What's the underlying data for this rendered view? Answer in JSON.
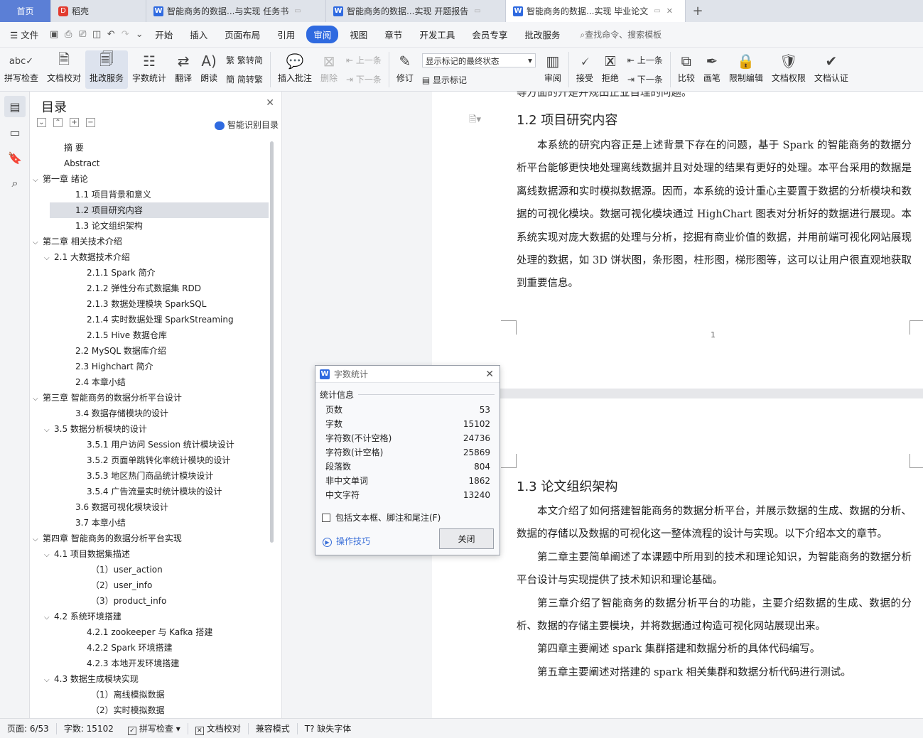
{
  "tabs": [
    {
      "label": "首页",
      "type": "home"
    },
    {
      "label": "稻壳",
      "type": "docer"
    },
    {
      "label": "智能商务的数据...与实现 任务书",
      "type": "doc"
    },
    {
      "label": "智能商务的数据...实现 开题报告",
      "type": "doc"
    },
    {
      "label": "智能商务的数据...实现 毕业论文",
      "type": "doc",
      "active": true
    }
  ],
  "menubar": {
    "file": "文件",
    "items": [
      "开始",
      "插入",
      "页面布局",
      "引用",
      "审阅",
      "视图",
      "章节",
      "开发工具",
      "会员专享",
      "批改服务"
    ],
    "active": "审阅",
    "search": "查找命令、搜索模板"
  },
  "ribbon": {
    "spellcheck": "拼写检查",
    "proofread": "文档校对",
    "correction": "批改服务",
    "wordcount": "字数统计",
    "translate": "翻译",
    "readaloud": "朗读",
    "trad": "繁转简",
    "simp": "简转繁",
    "insert_comment": "插入批注",
    "delete": "删除",
    "prev": "上一条",
    "next": "下一条",
    "revise": "修订",
    "markup_select": "显示标记的最终状态",
    "show_markup": "显示标记",
    "review": "审阅",
    "accept": "接受",
    "reject": "拒绝",
    "prev2": "上一条",
    "next2": "下一条",
    "compare": "比较",
    "pen": "画笔",
    "restrict": "限制编辑",
    "doc_perm": "文档权限",
    "doc_cert": "文档认证"
  },
  "toc": {
    "title": "目录",
    "smart": "智能识别目录",
    "items": [
      {
        "label": "摘  要",
        "level": 1,
        "arrow": ""
      },
      {
        "label": "Abstract",
        "level": 1,
        "arrow": ""
      },
      {
        "label": "第一章  绪论",
        "level": 0,
        "arrow": "v"
      },
      {
        "label": "1.1 项目背景和意义",
        "level": 2,
        "arrow": ""
      },
      {
        "label": "1.2 项目研究内容",
        "level": 2,
        "arrow": "",
        "selected": true
      },
      {
        "label": "1.3 论文组织架构",
        "level": 2,
        "arrow": ""
      },
      {
        "label": "第二章  相关技术介绍",
        "level": 0,
        "arrow": "v"
      },
      {
        "label": "2.1 大数据技术介绍",
        "level": 1.5,
        "arrow": "v"
      },
      {
        "label": "2.1.1  Spark 简介",
        "level": 3,
        "arrow": ""
      },
      {
        "label": "2.1.2  弹性分布式数据集 RDD",
        "level": 3,
        "arrow": ""
      },
      {
        "label": "2.1.3 数据处理模块 SparkSQL",
        "level": 3,
        "arrow": ""
      },
      {
        "label": "2.1.4 实时数据处理 SparkStreaming",
        "level": 3,
        "arrow": ""
      },
      {
        "label": "2.1.5 Hive 数据仓库",
        "level": 3,
        "arrow": ""
      },
      {
        "label": "2.2 MySQL 数据库介绍",
        "level": 2,
        "arrow": ""
      },
      {
        "label": "2.3 Highchart 简介",
        "level": 2,
        "arrow": ""
      },
      {
        "label": "2.4  本章小结",
        "level": 2,
        "arrow": ""
      },
      {
        "label": "第三章  智能商务的数据分析平台设计",
        "level": 0,
        "arrow": "v"
      },
      {
        "label": "3.4 数据存储模块的设计",
        "level": 2,
        "arrow": ""
      },
      {
        "label": "3.5 数据分析模块的设计",
        "level": 1.5,
        "arrow": "v"
      },
      {
        "label": "3.5.1  用户访问 Session 统计模块设计",
        "level": 3,
        "arrow": ""
      },
      {
        "label": "3.5.2  页面单跳转化率统计模块的设计",
        "level": 3,
        "arrow": ""
      },
      {
        "label": "3.5.3  地区热门商品统计模块设计",
        "level": 3,
        "arrow": ""
      },
      {
        "label": "3.5.4 广告流量实时统计模块的设计",
        "level": 3,
        "arrow": ""
      },
      {
        "label": "3.6 数据可视化模块设计",
        "level": 2,
        "arrow": ""
      },
      {
        "label": "3.7  本章小结",
        "level": 2,
        "arrow": ""
      },
      {
        "label": "第四章  智能商务的数据分析平台实现",
        "level": 0,
        "arrow": "v"
      },
      {
        "label": "4.1 项目数据集描述",
        "level": 1.5,
        "arrow": "v"
      },
      {
        "label": "（1）user_action",
        "level": 3.5,
        "arrow": ""
      },
      {
        "label": "（2）user_info",
        "level": 3.5,
        "arrow": ""
      },
      {
        "label": "（3）product_info",
        "level": 3.5,
        "arrow": ""
      },
      {
        "label": "4.2 系统环境搭建",
        "level": 1.5,
        "arrow": "v"
      },
      {
        "label": "4.2.1 zookeeper 与 Kafka 搭建",
        "level": 3,
        "arrow": ""
      },
      {
        "label": "4.2.2 Spark 环境搭建",
        "level": 3,
        "arrow": ""
      },
      {
        "label": "4.2.3 本地开发环境搭建",
        "level": 3,
        "arrow": ""
      },
      {
        "label": "4.3 数据生成模块实现",
        "level": 1.5,
        "arrow": "v"
      },
      {
        "label": "（1）离线模拟数据",
        "level": 3.5,
        "arrow": ""
      },
      {
        "label": "（2）实时模拟数据",
        "level": 3.5,
        "arrow": ""
      }
    ]
  },
  "document": {
    "top_fragment": "等方面的开是并规田正业目理的问题。",
    "h12": "1.2 项目研究内容",
    "p12": "本系统的研究内容正是上述背景下存在的问题，基于 Spark 的智能商务的数据分析平台能够更快地处理离线数据并且对处理的结果有更好的处理。本平台采用的数据是离线数据源和实时模拟数据源。因而，本系统的设计重心主要置于数据的分析模块和数据的可视化模块。数据可视化模块通过 HighChart 图表对分析好的数据进行展现。本系统实现对庞大数据的处理与分析，挖掘有商业价值的数据，并用前端可视化网站展现处理的数据，如 3D 饼状图，条形图，柱形图，梯形图等，这可以让用户很直观地获取到重要信息。",
    "page_number": "1",
    "h13": "1.3 论文组织架构",
    "p13": [
      "本文介绍了如何搭建智能商务的数据分析平台，并展示数据的生成、数据的分析、数据的存储以及数据的可视化这一整体流程的设计与实现。以下介绍本文的章节。",
      "第二章主要简单阐述了本课题中所用到的技术和理论知识，为智能商务的数据分析平台设计与实现提供了技术知识和理论基础。",
      "第三章介绍了智能商务的数据分析平台的功能，主要介绍数据的生成、数据的分析、数据的存储主要模块，并将数据通过构造可视化网站展现出来。",
      "第四章主要阐述 spark 集群搭建和数据分析的具体代码编写。",
      "第五章主要阐述对搭建的 spark 相关集群和数据分析代码进行测试。"
    ]
  },
  "dialog": {
    "title": "字数统计",
    "section": "统计信息",
    "stats": [
      {
        "label": "页数",
        "value": "53"
      },
      {
        "label": "字数",
        "value": "15102"
      },
      {
        "label": "字符数(不计空格)",
        "value": "24736"
      },
      {
        "label": "字符数(计空格)",
        "value": "25869"
      },
      {
        "label": "段落数",
        "value": "804"
      },
      {
        "label": "非中文单词",
        "value": "1862"
      },
      {
        "label": "中文字符",
        "value": "13240"
      }
    ],
    "checkbox": "包括文本框、脚注和尾注(F)",
    "tips": "操作技巧",
    "close": "关闭"
  },
  "status": {
    "page": "页面: 6/53",
    "words": "字数: 15102",
    "spell": "拼写检查",
    "proof": "文档校对",
    "compat": "兼容模式",
    "missing_font": "缺失字体"
  }
}
